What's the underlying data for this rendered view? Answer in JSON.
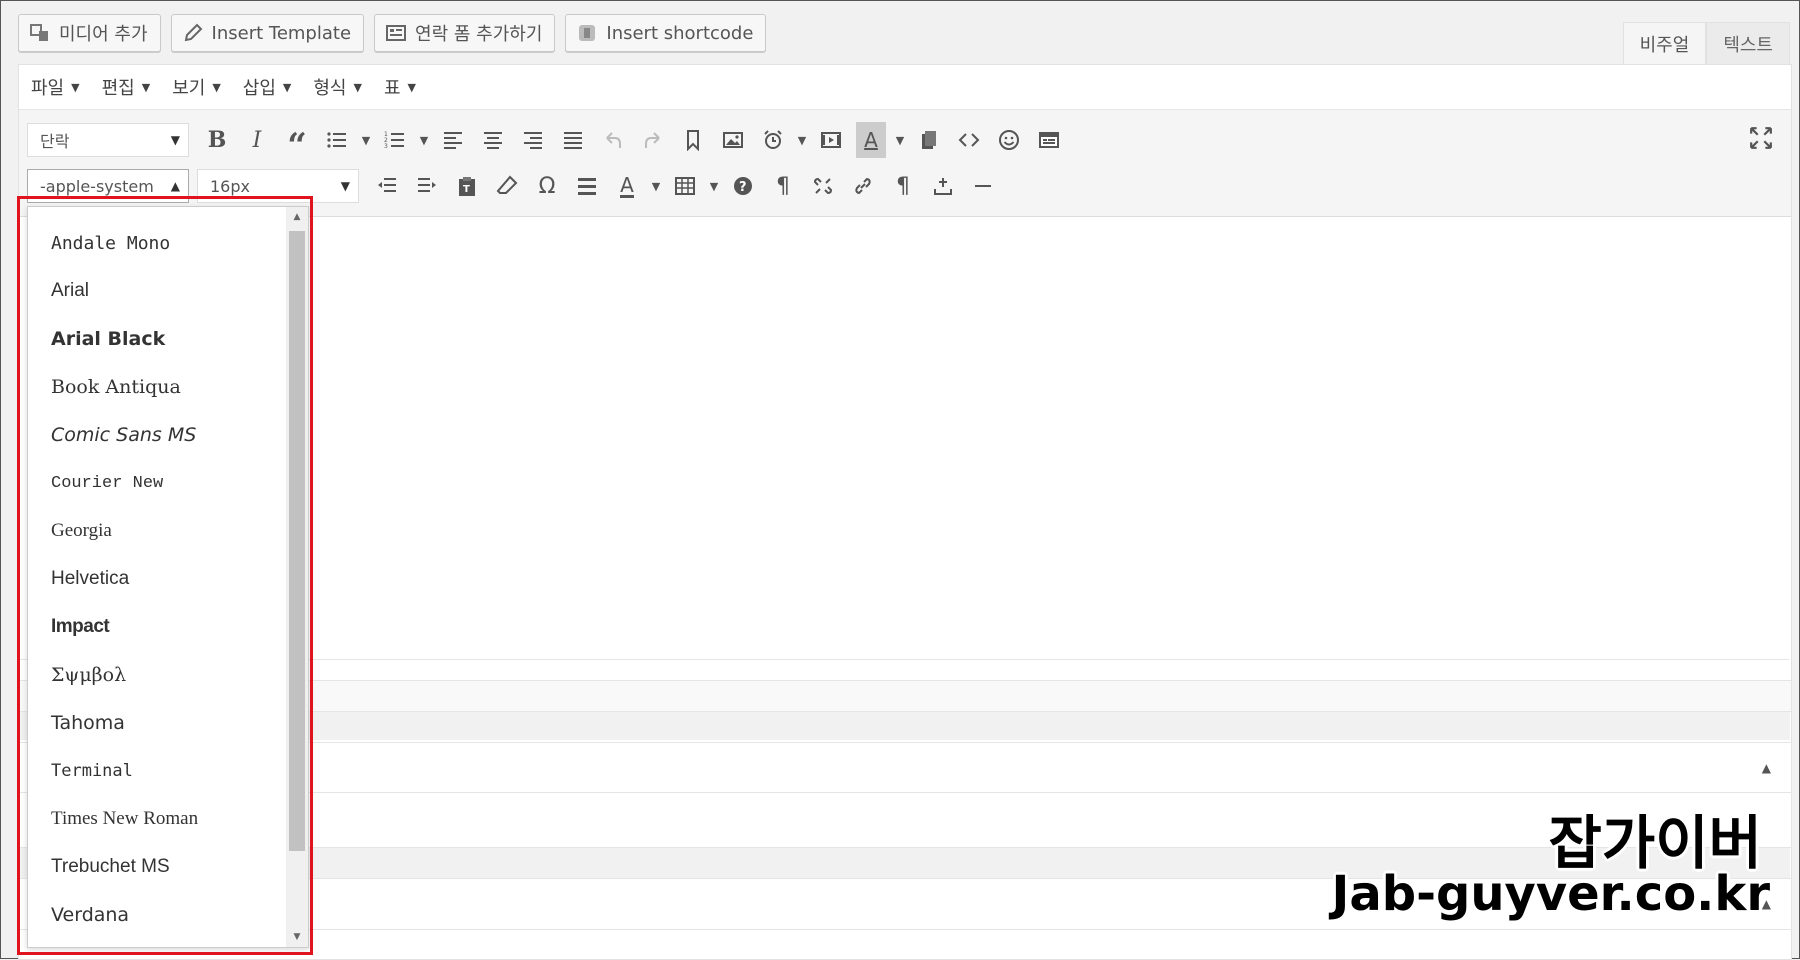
{
  "media_buttons": [
    {
      "label": "미디어 추가",
      "icon": "media-icon"
    },
    {
      "label": "Insert Template",
      "icon": "pencil-icon"
    },
    {
      "label": "연락 폼 추가하기",
      "icon": "form-icon"
    },
    {
      "label": "Insert shortcode",
      "icon": "shortcode-icon"
    }
  ],
  "tabs": {
    "visual": "비주얼",
    "text": "텍스트"
  },
  "menubar": [
    "파일",
    "편집",
    "보기",
    "삽입",
    "형식",
    "표"
  ],
  "toolbar": {
    "paragraph_select": "단락",
    "font_family_select": "-apple-system",
    "font_size_select": "16px"
  },
  "font_dropdown": {
    "items": [
      "Andale Mono",
      "Arial",
      "Arial Black",
      "Book Antiqua",
      "Comic Sans MS",
      "Courier New",
      "Georgia",
      "Helvetica",
      "Impact",
      "Σψμβολ",
      "Tahoma",
      "Terminal",
      "Times New Roman",
      "Trebuchet MS",
      "Verdana"
    ]
  },
  "watermark": {
    "line1": "잡가이버",
    "line2": "Jab-guyver.co.kr"
  },
  "colors": {
    "highlight_border": "#e0141e"
  }
}
